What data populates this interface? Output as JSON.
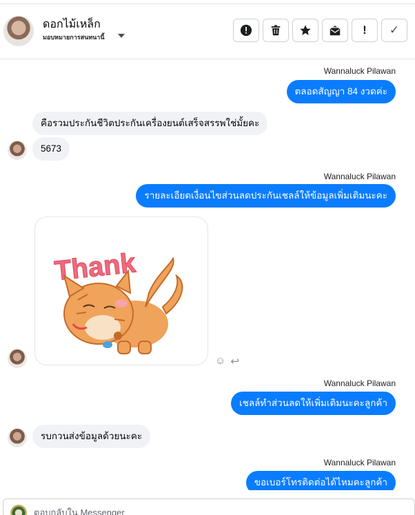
{
  "header": {
    "name": "ดอกไม้เหล็ก",
    "subtitle": "มอบหมายการสนทนานี้",
    "toolbar": [
      {
        "name": "report-icon"
      },
      {
        "name": "trash-icon"
      },
      {
        "name": "star-icon"
      },
      {
        "name": "mark-unread-icon"
      },
      {
        "name": "spam-icon",
        "glyph": "!"
      },
      {
        "name": "done-icon",
        "glyph": "✓"
      }
    ]
  },
  "thread": {
    "messages": [
      {
        "sender": "Wannaluck Pilawan",
        "text": "ตลอดสัญญา  84 งวดค่ะ",
        "direction": "outgoing"
      },
      {
        "text": "คือรวมประกันชีวิตประกันเครื่องยนต์เสร็จสรรพใช่มั้ยคะ",
        "direction": "incoming"
      },
      {
        "text": "5673",
        "direction": "incoming"
      },
      {
        "sender": "Wannaluck Pilawan",
        "text": "รายละเอียดเงื่อนไขส่วนลดประกันเชลล์ให้ข้อมูลเพิ่มเติมนะคะ",
        "direction": "outgoing"
      },
      {
        "sticker": "Thank",
        "direction": "incoming"
      },
      {
        "sender": "Wannaluck Pilawan",
        "text": "เชลล์ทำส่วนลดให้เพิ่มเติมนะคะลูกค้า",
        "direction": "outgoing"
      },
      {
        "text": "รบกวนส่งข้อมูลด้วยนะคะ",
        "direction": "incoming"
      },
      {
        "sender": "Wannaluck Pilawan",
        "text": "ขอเบอร์โทรติดต่อได้ไหมคะลูกค้า",
        "direction": "outgoing"
      }
    ]
  },
  "composer": {
    "placeholder": "ตอบกลับใน Messenger"
  },
  "colors": {
    "outgoing_bubble": "#0a7cff",
    "incoming_bubble": "#f0f2f5"
  }
}
